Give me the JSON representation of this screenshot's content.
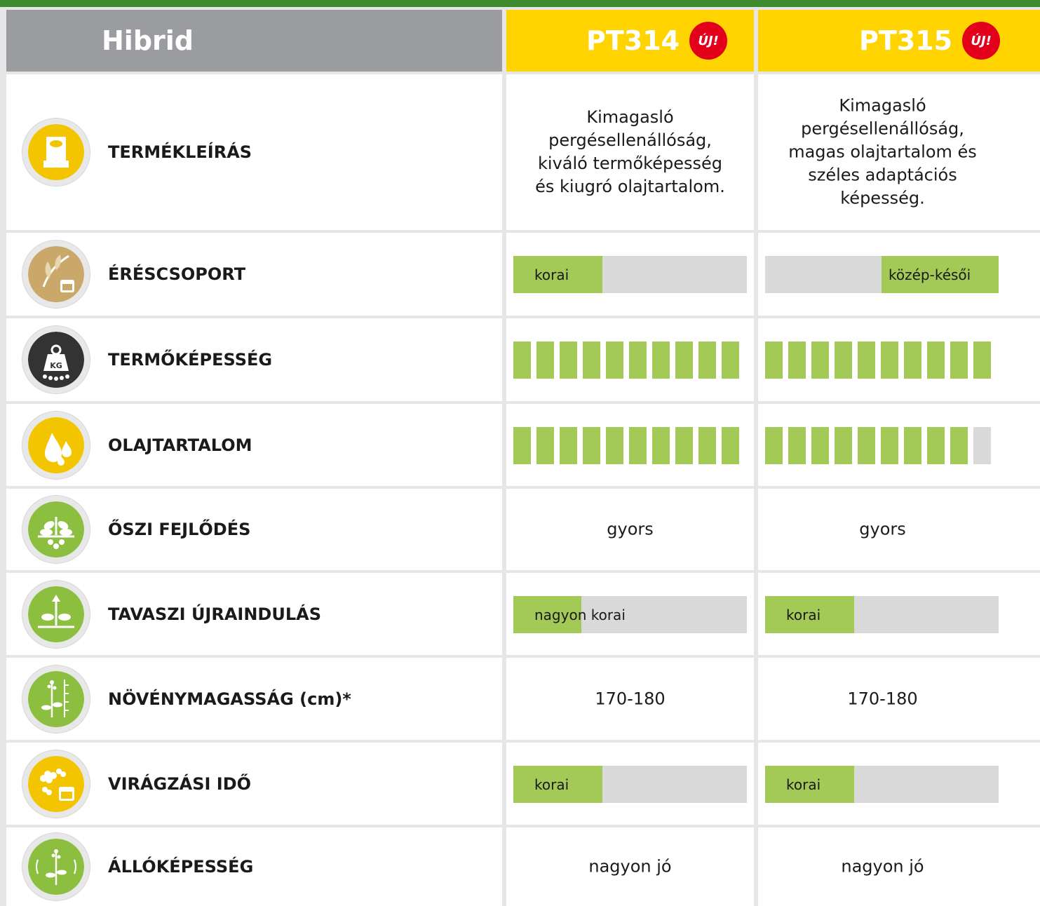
{
  "header": {
    "label": "Hibrid",
    "products": [
      {
        "name": "PT314",
        "badge": "ÚJ!"
      },
      {
        "name": "PT315",
        "badge": "ÚJ!"
      }
    ]
  },
  "colors": {
    "brand_green": "#3d8a2f",
    "header_yellow": "#ffd400",
    "header_grey": "#9a9ca0",
    "bar_fill": "#a3c957",
    "bar_empty": "#d9d9d9",
    "badge_red": "#e2001a"
  },
  "rows": [
    {
      "label": "TERMÉKLEÍRÁS",
      "icon": "seed-bag-icon",
      "type": "text",
      "values": [
        "Kimagasló pergésellenállóság, kiváló termőképesség és kiugró olajtartalom.",
        "Kimagasló pergésellenállóság, magas olajtartalom és széles adaptációs képesség."
      ]
    },
    {
      "label": "ÉRÉSCSOPORT",
      "icon": "leaf-calendar-icon",
      "type": "bar",
      "values": [
        {
          "text": "korai",
          "fill": 0.38,
          "position": "start"
        },
        {
          "text": "közép-késői",
          "fill": 0.5,
          "position": "end"
        }
      ]
    },
    {
      "label": "TERMŐKÉPESSÉG",
      "icon": "kg-weight-icon",
      "type": "segments",
      "values": [
        {
          "filled": 10,
          "total": 10
        },
        {
          "filled": 10,
          "total": 10
        }
      ]
    },
    {
      "label": "OLAJTARTALOM",
      "icon": "oil-drops-icon",
      "type": "segments",
      "values": [
        {
          "filled": 10,
          "total": 10
        },
        {
          "filled": 9,
          "total": 10
        }
      ]
    },
    {
      "label": "ŐSZI FEJLŐDÉS",
      "icon": "rosette-plant-icon",
      "type": "text",
      "values": [
        "gyors",
        "gyors"
      ]
    },
    {
      "label": "TAVASZI ÚJRAINDULÁS",
      "icon": "plant-arrow-up-icon",
      "type": "bar",
      "values": [
        {
          "text": "nagyon korai",
          "fill": 0.29,
          "position": "start"
        },
        {
          "text": "korai",
          "fill": 0.38,
          "position": "start"
        }
      ]
    },
    {
      "label": "NÖVÉNYMAGASSÁG (cm)*",
      "icon": "plant-height-ruler-icon",
      "type": "text",
      "values": [
        "170-180",
        "170-180"
      ]
    },
    {
      "label": "VIRÁGZÁSI IDŐ",
      "icon": "flower-calendar-icon",
      "type": "bar",
      "values": [
        {
          "text": "korai",
          "fill": 0.38,
          "position": "start"
        },
        {
          "text": "korai",
          "fill": 0.38,
          "position": "start"
        }
      ]
    },
    {
      "label": "ÁLLÓKÉPESSÉG",
      "icon": "standing-plant-icon",
      "type": "text",
      "values": [
        "nagyon jó",
        "nagyon jó"
      ]
    }
  ]
}
